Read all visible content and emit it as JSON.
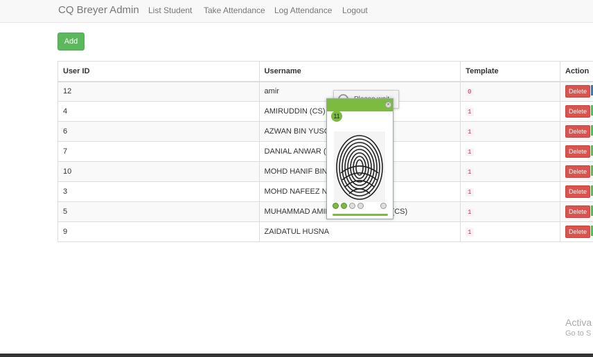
{
  "navbar": {
    "brand": "CQ Breyer Admin",
    "links": [
      "List Student",
      "Take Attendance",
      "Log Attendance",
      "Logout"
    ]
  },
  "toolbar": {
    "add_label": "Add"
  },
  "table": {
    "headers": [
      "User ID",
      "Username",
      "Template",
      "Action"
    ],
    "rows": [
      {
        "id": "12",
        "username": "amir",
        "template": "0"
      },
      {
        "id": "4",
        "username": "AMIRUDDIN (CS)",
        "template": "1"
      },
      {
        "id": "6",
        "username": "AZWAN BIN YUSO",
        "template": "1"
      },
      {
        "id": "7",
        "username": "DANIAL ANWAR (C",
        "template": "1"
      },
      {
        "id": "10",
        "username": "MOHD HANIF BIN",
        "template": "1"
      },
      {
        "id": "3",
        "username": "MOHD NAFEEZ NO",
        "template": "1"
      },
      {
        "id": "5",
        "username": "MUHAMMAD AMIR",
        "username_tail": "N (CS)",
        "template": "1"
      },
      {
        "id": "9",
        "username": "ZAIDATUL HUSNA",
        "template": "1"
      }
    ],
    "delete_label": "Delete"
  },
  "please_wait": {
    "text": "Please wait"
  },
  "fingerprint_dialog": {
    "count": "11",
    "close_symbol": "×",
    "scans_done": 2,
    "scans_total": 5
  },
  "watermark": {
    "line1": "Activa",
    "line2": "Go to S"
  },
  "colors": {
    "accent": "#7cbb3f",
    "danger": "#d9534f",
    "success": "#5cb85c"
  }
}
